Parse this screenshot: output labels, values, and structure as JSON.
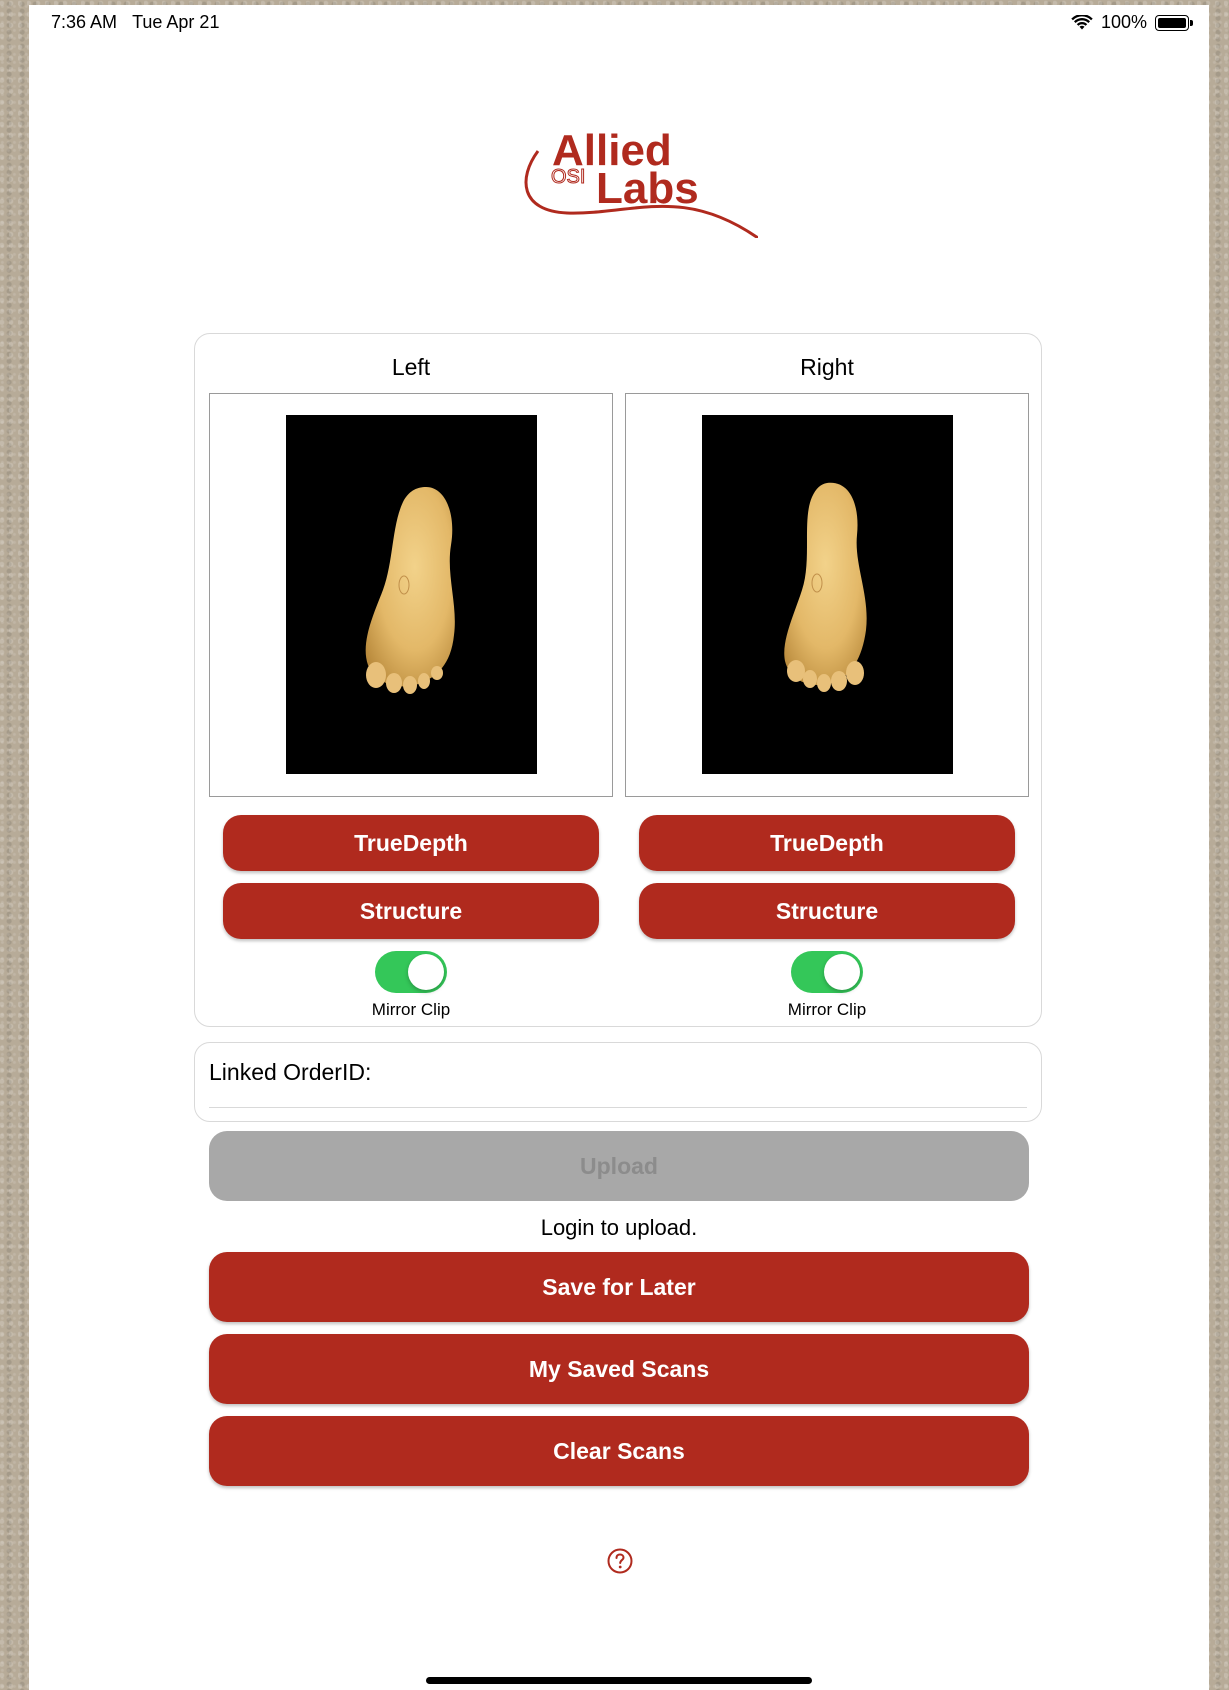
{
  "status_bar": {
    "time": "7:36 AM",
    "date": "Tue Apr 21",
    "battery": "100%",
    "wifi_icon": "wifi-icon",
    "battery_icon": "battery-full-icon"
  },
  "logo": {
    "alt": "Allied OSI Labs"
  },
  "scan_card": {
    "left": {
      "label": "Left",
      "truedepth_label": "TrueDepth",
      "structure_label": "Structure",
      "mirror_label": "Mirror Clip",
      "mirror_on": true
    },
    "right": {
      "label": "Right",
      "truedepth_label": "TrueDepth",
      "structure_label": "Structure",
      "mirror_label": "Mirror Clip",
      "mirror_on": true
    }
  },
  "order": {
    "label": "Linked OrderID:",
    "value": ""
  },
  "actions": {
    "upload_label": "Upload",
    "upload_enabled": false,
    "login_message": "Login to upload.",
    "save_later_label": "Save for Later",
    "saved_scans_label": "My Saved Scans",
    "clear_label": "Clear Scans"
  },
  "help_icon": "question-circle-icon",
  "colors": {
    "brand_red": "#b02a1e",
    "toggle_green": "#34c759",
    "disabled_gray": "#a8a8a8"
  }
}
